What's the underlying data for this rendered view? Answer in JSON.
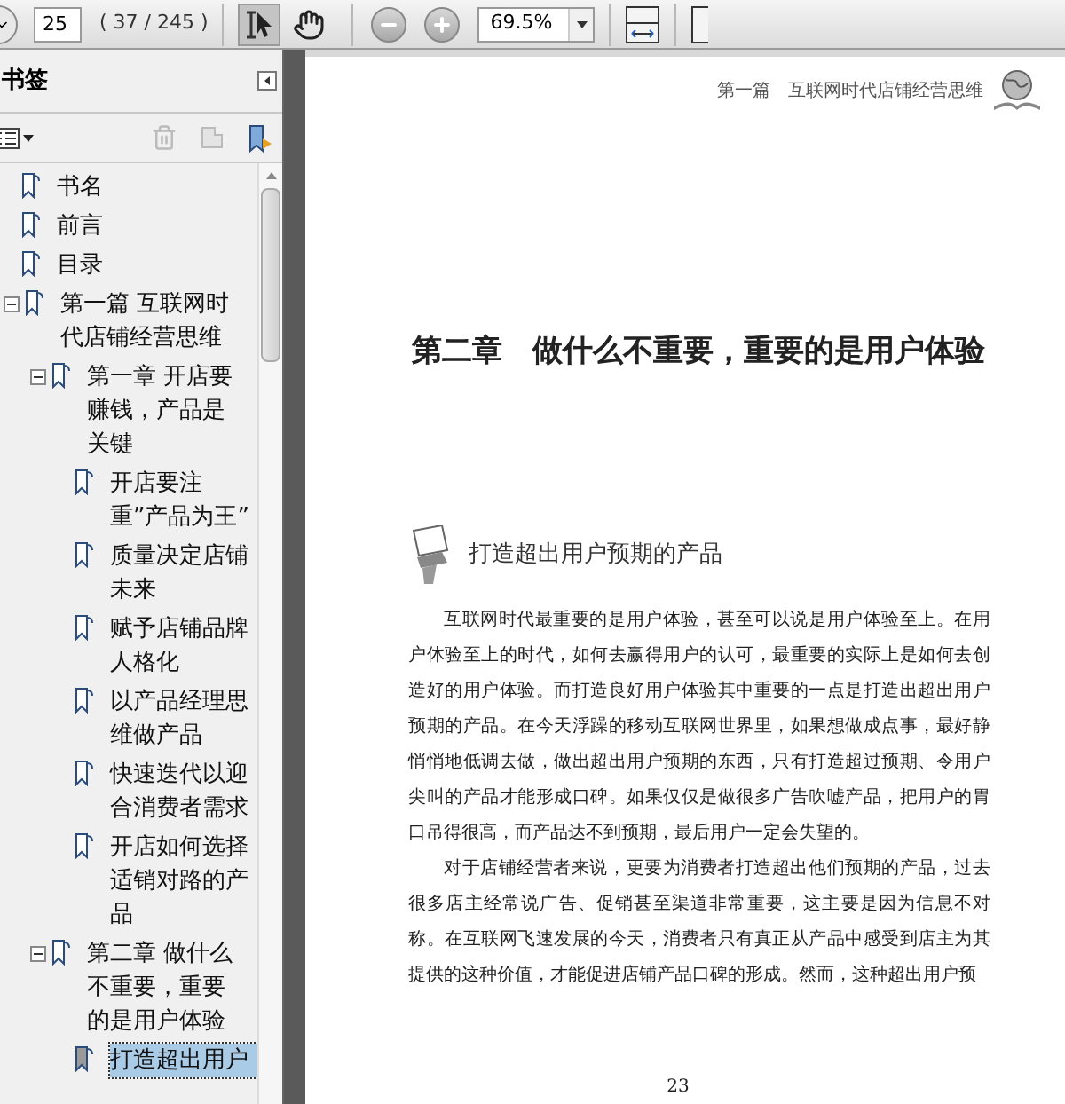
{
  "toolbar": {
    "page_number": "25",
    "page_count": "( 37 / 245 )",
    "tools": [
      {
        "kind": "select",
        "selected": true
      },
      {
        "kind": "hand",
        "selected": false
      }
    ],
    "zoom": "69.5%"
  },
  "bookmarks_panel": {
    "title": "书签",
    "items": [
      {
        "label": "书名"
      },
      {
        "label": "前言"
      },
      {
        "label": "目录"
      },
      {
        "label": "第一篇  互联网时代店铺经营思维",
        "expanded": true,
        "children": [
          {
            "label": "第一章  开店要赚钱，产品是关键",
            "expanded": true,
            "children": [
              {
                "label": "开店要注重”产品为王”",
                "selected": false
              },
              {
                "label": "质量决定店铺未来",
                "selected": false
              },
              {
                "label": "赋予店铺品牌人格化",
                "selected": false
              },
              {
                "label": "以产品经理思维做产品",
                "selected": false
              },
              {
                "label": "快速迭代以迎合消费者需求",
                "selected": false
              },
              {
                "label": "开店如何选择适销对路的产品",
                "selected": false
              }
            ]
          },
          {
            "label": "第二章  做什么不重要，重要的是用户体验",
            "expanded": true,
            "children": [
              {
                "label": "打造超出用户",
                "selected": true
              }
            ]
          }
        ]
      }
    ]
  },
  "page": {
    "running_header": "第一篇　互联网时代店铺经营思维",
    "chapter_title": "第二章　做什么不重要，重要的是用户体验",
    "section_heading": "打造超出用户预期的产品",
    "paragraphs": [
      "互联网时代最重要的是用户体验，甚至可以说是用户体验至上。在用户体验至上的时代，如何去赢得用户的认可，最重要的实际上是如何去创造好的用户体验。而打造良好用户体验其中重要的一点是打造出超出用户预期的产品。在今天浮躁的移动互联网世界里，如果想做成点事，最好静悄悄地低调去做，做出超出用户预期的东西，只有打造超过预期、令用户尖叫的产品才能形成口碑。如果仅仅是做很多广告吹嘘产品，把用户的胃口吊得很高，而产品达不到预期，最后用户一定会失望的。",
      "对于店铺经营者来说，更要为消费者打造超出他们预期的产品，过去很多店主经常说广告、促销甚至渠道非常重要，这主要是因为信息不对称。在互联网飞速发展的今天，消费者只有真正从产品中感受到店主为其提供的这种价值，才能促进店铺产品口碑的形成。然而，这种超出用户预"
    ],
    "page_number": "23"
  }
}
